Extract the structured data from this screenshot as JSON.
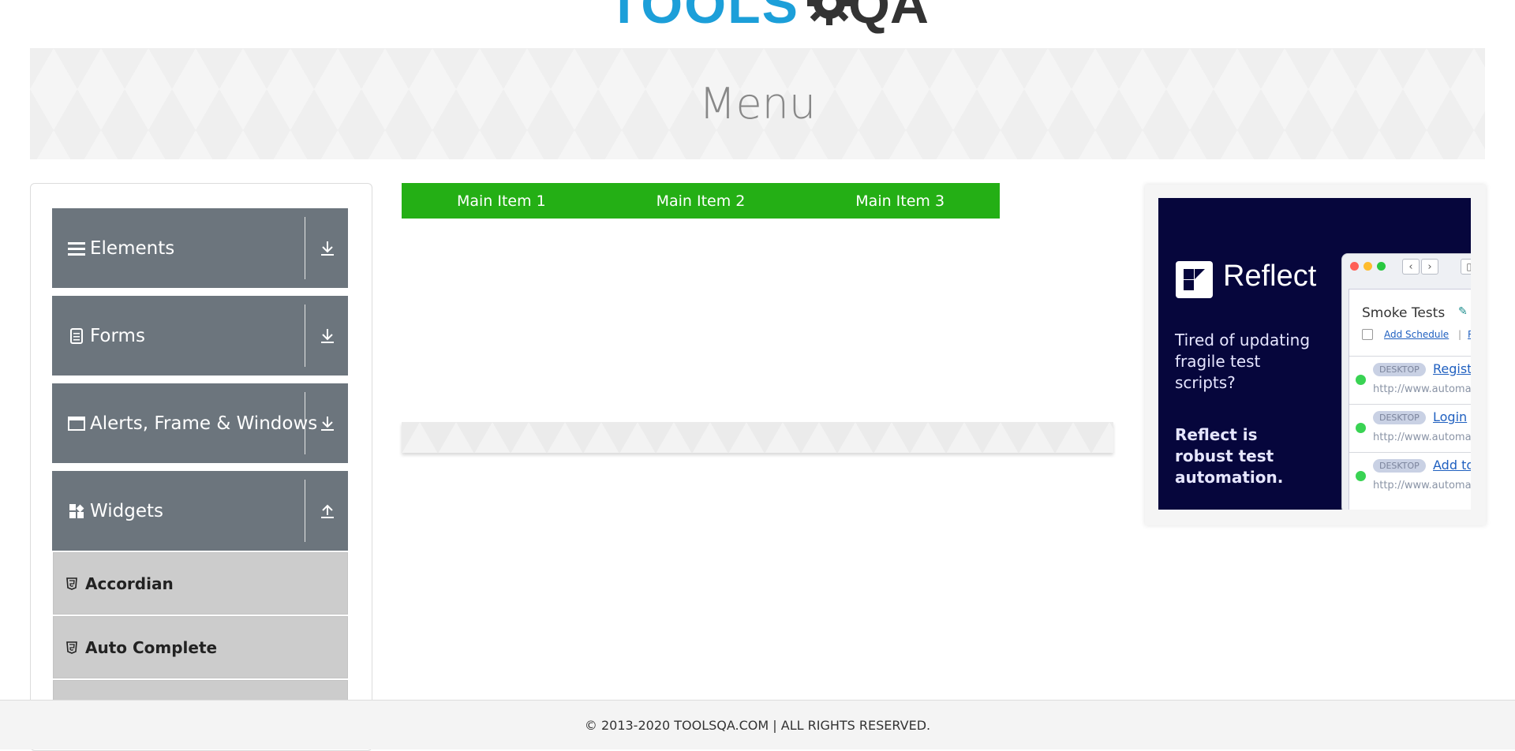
{
  "header": {
    "logo_text_left": "TOOLS",
    "logo_text_right": "QA",
    "page_title": "Menu"
  },
  "sidebar": {
    "groups": [
      {
        "label": "Elements",
        "icon": "hamburger-icon",
        "state": "collapsed"
      },
      {
        "label": "Forms",
        "icon": "document-icon",
        "state": "collapsed"
      },
      {
        "label": "Alerts, Frame & Windows",
        "icon": "window-icon",
        "state": "collapsed"
      },
      {
        "label": "Widgets",
        "icon": "widgets-icon",
        "state": "expanded"
      }
    ],
    "widgets_items": [
      {
        "label": "Accordian",
        "icon": "html5-icon"
      },
      {
        "label": "Auto Complete",
        "icon": "html5-icon"
      }
    ]
  },
  "menu": {
    "items": [
      "Main Item 1",
      "Main Item 2",
      "Main Item 3"
    ],
    "bar_color": "#24af15"
  },
  "ad": {
    "brand": "Reflect",
    "text1": "Tired of updating fragile test scripts?",
    "text2": "Reflect is robust test automation.",
    "panel_title": "Smoke Tests",
    "add_schedule": "Add Schedule",
    "run_link": "Ru",
    "tests": [
      {
        "tag": "DESKTOP",
        "name": "Registr",
        "url": "http://www.automat"
      },
      {
        "tag": "DESKTOP",
        "name": "Login",
        "url": "http://www.automat"
      },
      {
        "tag": "DESKTOP",
        "name": "Add to",
        "url": "http://www.automat"
      }
    ]
  },
  "footer": {
    "text": "© 2013-2020 TOOLSQA.COM | ALL RIGHTS RESERVED."
  }
}
